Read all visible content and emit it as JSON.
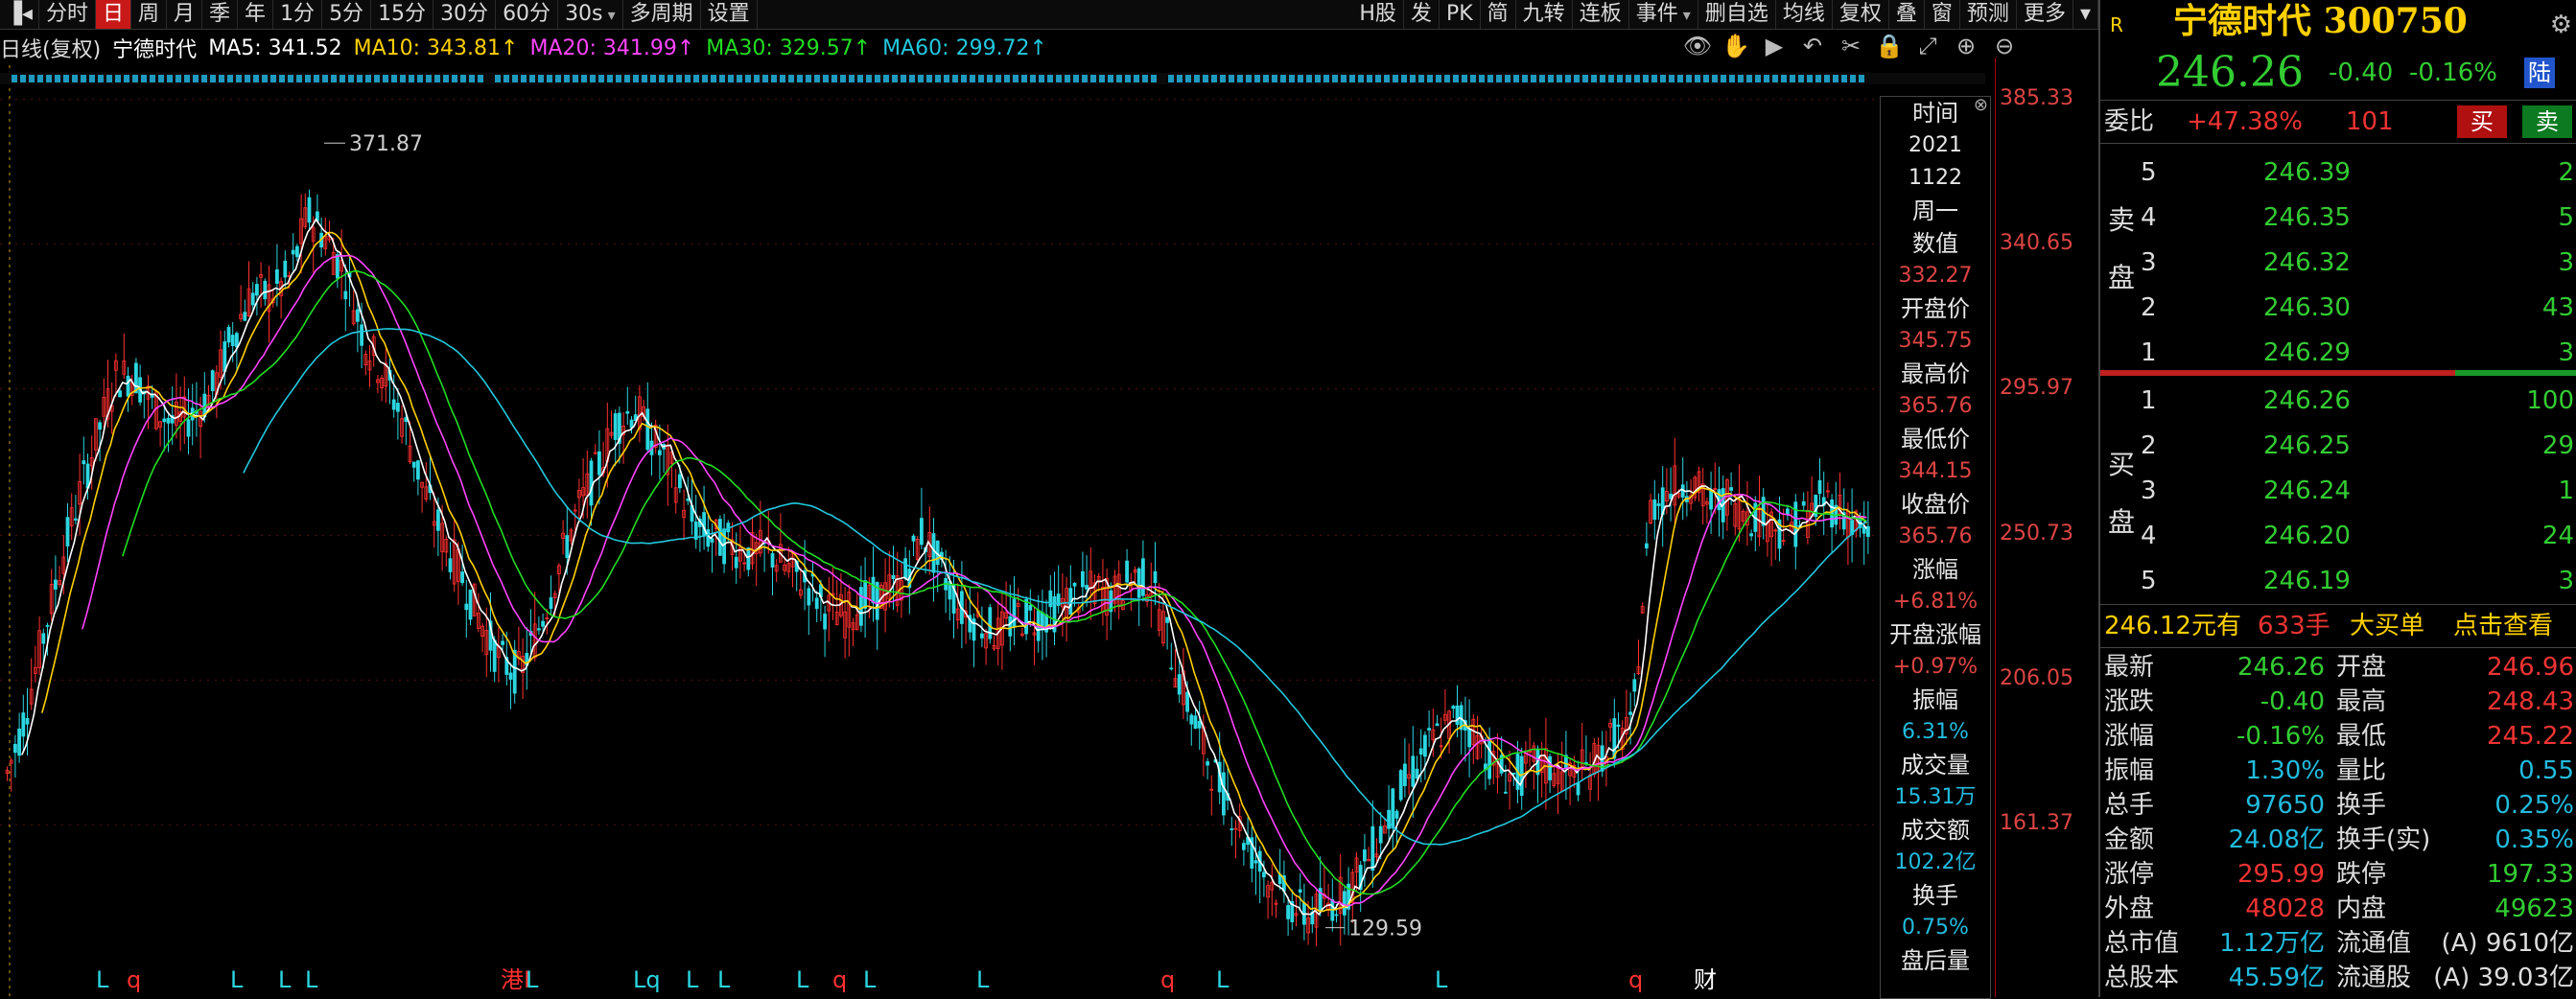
{
  "toolbar": {
    "left_items": [
      "分时",
      "日",
      "周",
      "月",
      "季",
      "年",
      "1分",
      "5分",
      "15分",
      "30分",
      "60分",
      "30s",
      "多周期",
      "设置"
    ],
    "active_index": 1,
    "dropdown_index": 11,
    "right_items": [
      "H股",
      "发",
      "PK",
      "简",
      "九转",
      "连板",
      "事件",
      "删自选",
      "均线",
      "复权",
      "叠",
      "窗",
      "预测",
      "更多"
    ]
  },
  "legend": {
    "period": "日线(复权)",
    "stock": "宁德时代",
    "ma5": "MA5: 341.52",
    "ma10": "MA10: 343.81↑",
    "ma20": "MA20: 341.99↑",
    "ma30": "MA30: 329.57↑",
    "ma60": "MA60: 299.72↑"
  },
  "colors": {
    "ma5": "#ffffff",
    "ma10": "#ffd000",
    "ma20": "#ff44ff",
    "ma30": "#22dd22",
    "ma60": "#22c8dd",
    "up": "#ff3030",
    "down": "#2bd6e0",
    "axis": "#d44444"
  },
  "price_axis": [
    "385.33",
    "340.65",
    "295.97",
    "250.73",
    "206.05",
    "161.37"
  ],
  "chart_data": {
    "type": "candlestick",
    "title": "宁德时代 日线(复权)",
    "ylim": [
      120,
      390
    ],
    "annotations": {
      "high": "371.87",
      "low": "129.59"
    },
    "close_path": [
      [
        0,
        172
      ],
      [
        20,
        190
      ],
      [
        40,
        215
      ],
      [
        60,
        240
      ],
      [
        80,
        262
      ],
      [
        100,
        282
      ],
      [
        120,
        300
      ],
      [
        140,
        300
      ],
      [
        160,
        290
      ],
      [
        180,
        285
      ],
      [
        200,
        288
      ],
      [
        220,
        295
      ],
      [
        240,
        312
      ],
      [
        260,
        325
      ],
      [
        280,
        325
      ],
      [
        300,
        330
      ],
      [
        320,
        350
      ],
      [
        340,
        342
      ],
      [
        360,
        330
      ],
      [
        380,
        310
      ],
      [
        400,
        300
      ],
      [
        420,
        285
      ],
      [
        440,
        265
      ],
      [
        460,
        250
      ],
      [
        480,
        238
      ],
      [
        500,
        224
      ],
      [
        520,
        212
      ],
      [
        540,
        208
      ],
      [
        560,
        222
      ],
      [
        580,
        240
      ],
      [
        600,
        258
      ],
      [
        620,
        270
      ],
      [
        640,
        285
      ],
      [
        660,
        290
      ],
      [
        680,
        280
      ],
      [
        700,
        270
      ],
      [
        720,
        255
      ],
      [
        740,
        250
      ],
      [
        760,
        248
      ],
      [
        780,
        245
      ],
      [
        800,
        246
      ],
      [
        820,
        240
      ],
      [
        840,
        236
      ],
      [
        860,
        228
      ],
      [
        880,
        226
      ],
      [
        900,
        230
      ],
      [
        920,
        232
      ],
      [
        940,
        236
      ],
      [
        960,
        252
      ],
      [
        980,
        240
      ],
      [
        1000,
        228
      ],
      [
        1020,
        224
      ],
      [
        1040,
        220
      ],
      [
        1060,
        226
      ],
      [
        1080,
        225
      ],
      [
        1100,
        228
      ],
      [
        1120,
        232
      ],
      [
        1140,
        234
      ],
      [
        1160,
        232
      ],
      [
        1180,
        238
      ],
      [
        1200,
        236
      ],
      [
        1220,
        214
      ],
      [
        1240,
        196
      ],
      [
        1260,
        180
      ],
      [
        1280,
        168
      ],
      [
        1300,
        155
      ],
      [
        1320,
        145
      ],
      [
        1340,
        138
      ],
      [
        1360,
        133
      ],
      [
        1380,
        136
      ],
      [
        1400,
        140
      ],
      [
        1420,
        148
      ],
      [
        1440,
        160
      ],
      [
        1460,
        172
      ],
      [
        1480,
        182
      ],
      [
        1500,
        190
      ],
      [
        1520,
        195
      ],
      [
        1540,
        188
      ],
      [
        1560,
        178
      ],
      [
        1580,
        176
      ],
      [
        1600,
        180
      ],
      [
        1620,
        178
      ],
      [
        1640,
        176
      ],
      [
        1660,
        180
      ],
      [
        1680,
        188
      ],
      [
        1700,
        190
      ],
      [
        1720,
        260
      ],
      [
        1740,
        265
      ],
      [
        1760,
        268
      ],
      [
        1780,
        260
      ],
      [
        1800,
        262
      ],
      [
        1820,
        258
      ],
      [
        1840,
        256
      ],
      [
        1860,
        252
      ],
      [
        1880,
        256
      ],
      [
        1900,
        262
      ],
      [
        1920,
        258
      ],
      [
        1940,
        252
      ],
      [
        1950,
        246
      ]
    ],
    "markers": [
      "L",
      "q",
      "L",
      "L",
      "L",
      "港L",
      "L",
      "Lq",
      "L",
      "L",
      "L",
      "q",
      "L",
      "L",
      "q",
      "L",
      "L",
      "q",
      "财"
    ]
  },
  "datawin": [
    {
      "label": "时间",
      "value": "2021"
    },
    {
      "label": "",
      "value": "1122"
    },
    {
      "label": "周一",
      "value": ""
    },
    {
      "label": "数值",
      "value": "332.27"
    },
    {
      "label": "开盘价",
      "value": "345.75"
    },
    {
      "label": "最高价",
      "value": "365.76"
    },
    {
      "label": "最低价",
      "value": "344.15"
    },
    {
      "label": "收盘价",
      "value": "365.76"
    },
    {
      "label": "涨幅",
      "value": "+6.81%"
    },
    {
      "label": "开盘涨幅",
      "value": "+0.97%"
    },
    {
      "label": "振幅",
      "value": "6.31%"
    },
    {
      "label": "成交量",
      "value": "15.31万"
    },
    {
      "label": "成交额",
      "value": "102.2亿"
    },
    {
      "label": "换手",
      "value": "0.75%"
    },
    {
      "label": "盘后量",
      "value": ""
    }
  ],
  "panel": {
    "r_icon": "R",
    "title": "宁德时代 300750",
    "price": "246.26",
    "change": "-0.40",
    "change_pct": "-0.16%",
    "lu": "陆",
    "weibi_label": "委比",
    "weibi": "+47.38%",
    "weicha": "101",
    "buy_btn": "买",
    "sell_btn": "卖",
    "sell_side_label": "卖盘",
    "buy_side_label": "买盘",
    "asks": [
      {
        "lvl": "5",
        "price": "246.39",
        "vol": "2"
      },
      {
        "lvl": "4",
        "price": "246.35",
        "vol": "5"
      },
      {
        "lvl": "3",
        "price": "246.32",
        "vol": "3"
      },
      {
        "lvl": "2",
        "price": "246.30",
        "vol": "43"
      },
      {
        "lvl": "1",
        "price": "246.29",
        "vol": "3"
      }
    ],
    "bids": [
      {
        "lvl": "1",
        "price": "246.26",
        "vol": "100"
      },
      {
        "lvl": "2",
        "price": "246.25",
        "vol": "29"
      },
      {
        "lvl": "3",
        "price": "246.24",
        "vol": "1"
      },
      {
        "lvl": "4",
        "price": "246.20",
        "vol": "24"
      },
      {
        "lvl": "5",
        "price": "246.19",
        "vol": "3"
      }
    ],
    "bigorder": {
      "price": "246.12元有",
      "hands": "633手",
      "text": "大买单",
      "link": "点击查看"
    },
    "stats": [
      [
        "最新",
        "246.26",
        "开盘",
        "246.96"
      ],
      [
        "涨跌",
        "-0.40",
        "最高",
        "248.43"
      ],
      [
        "涨幅",
        "-0.16%",
        "最低",
        "245.22"
      ],
      [
        "振幅",
        "1.30%",
        "量比",
        "0.55"
      ],
      [
        "总手",
        "97650",
        "换手",
        "0.25%"
      ],
      [
        "金额",
        "24.08亿",
        "换手(实)",
        "0.35%"
      ],
      [
        "涨停",
        "295.99",
        "跌停",
        "197.33"
      ],
      [
        "外盘",
        "48028",
        "内盘",
        "49623"
      ],
      [
        "总市值",
        "1.12万亿",
        "流通值",
        "(A) 9610亿"
      ],
      [
        "总股本",
        "45.59亿",
        "流通股",
        "(A) 39.03亿"
      ]
    ]
  }
}
